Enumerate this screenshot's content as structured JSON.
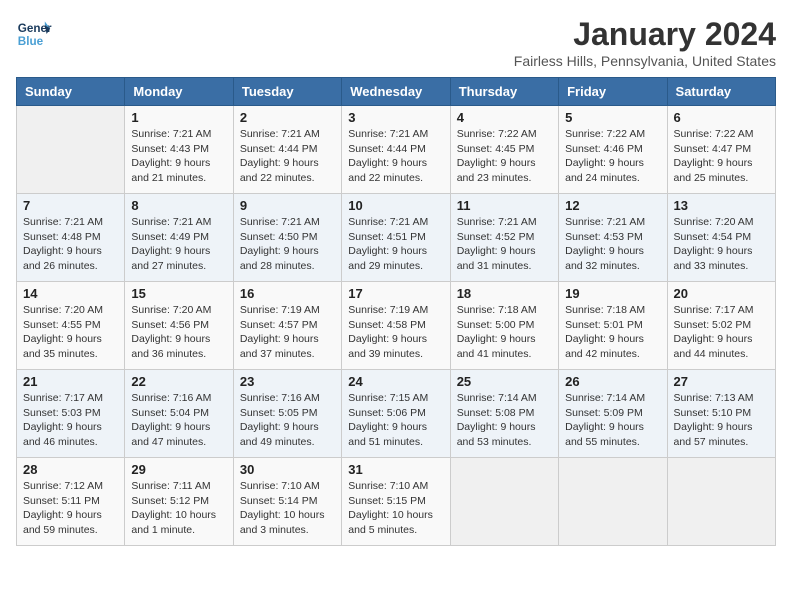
{
  "logo": {
    "line1": "General",
    "line2": "Blue"
  },
  "title": "January 2024",
  "location": "Fairless Hills, Pennsylvania, United States",
  "days_of_week": [
    "Sunday",
    "Monday",
    "Tuesday",
    "Wednesday",
    "Thursday",
    "Friday",
    "Saturday"
  ],
  "weeks": [
    [
      {
        "num": "",
        "info": ""
      },
      {
        "num": "1",
        "info": "Sunrise: 7:21 AM\nSunset: 4:43 PM\nDaylight: 9 hours\nand 21 minutes."
      },
      {
        "num": "2",
        "info": "Sunrise: 7:21 AM\nSunset: 4:44 PM\nDaylight: 9 hours\nand 22 minutes."
      },
      {
        "num": "3",
        "info": "Sunrise: 7:21 AM\nSunset: 4:44 PM\nDaylight: 9 hours\nand 22 minutes."
      },
      {
        "num": "4",
        "info": "Sunrise: 7:22 AM\nSunset: 4:45 PM\nDaylight: 9 hours\nand 23 minutes."
      },
      {
        "num": "5",
        "info": "Sunrise: 7:22 AM\nSunset: 4:46 PM\nDaylight: 9 hours\nand 24 minutes."
      },
      {
        "num": "6",
        "info": "Sunrise: 7:22 AM\nSunset: 4:47 PM\nDaylight: 9 hours\nand 25 minutes."
      }
    ],
    [
      {
        "num": "7",
        "info": "Sunrise: 7:21 AM\nSunset: 4:48 PM\nDaylight: 9 hours\nand 26 minutes."
      },
      {
        "num": "8",
        "info": "Sunrise: 7:21 AM\nSunset: 4:49 PM\nDaylight: 9 hours\nand 27 minutes."
      },
      {
        "num": "9",
        "info": "Sunrise: 7:21 AM\nSunset: 4:50 PM\nDaylight: 9 hours\nand 28 minutes."
      },
      {
        "num": "10",
        "info": "Sunrise: 7:21 AM\nSunset: 4:51 PM\nDaylight: 9 hours\nand 29 minutes."
      },
      {
        "num": "11",
        "info": "Sunrise: 7:21 AM\nSunset: 4:52 PM\nDaylight: 9 hours\nand 31 minutes."
      },
      {
        "num": "12",
        "info": "Sunrise: 7:21 AM\nSunset: 4:53 PM\nDaylight: 9 hours\nand 32 minutes."
      },
      {
        "num": "13",
        "info": "Sunrise: 7:20 AM\nSunset: 4:54 PM\nDaylight: 9 hours\nand 33 minutes."
      }
    ],
    [
      {
        "num": "14",
        "info": "Sunrise: 7:20 AM\nSunset: 4:55 PM\nDaylight: 9 hours\nand 35 minutes."
      },
      {
        "num": "15",
        "info": "Sunrise: 7:20 AM\nSunset: 4:56 PM\nDaylight: 9 hours\nand 36 minutes."
      },
      {
        "num": "16",
        "info": "Sunrise: 7:19 AM\nSunset: 4:57 PM\nDaylight: 9 hours\nand 37 minutes."
      },
      {
        "num": "17",
        "info": "Sunrise: 7:19 AM\nSunset: 4:58 PM\nDaylight: 9 hours\nand 39 minutes."
      },
      {
        "num": "18",
        "info": "Sunrise: 7:18 AM\nSunset: 5:00 PM\nDaylight: 9 hours\nand 41 minutes."
      },
      {
        "num": "19",
        "info": "Sunrise: 7:18 AM\nSunset: 5:01 PM\nDaylight: 9 hours\nand 42 minutes."
      },
      {
        "num": "20",
        "info": "Sunrise: 7:17 AM\nSunset: 5:02 PM\nDaylight: 9 hours\nand 44 minutes."
      }
    ],
    [
      {
        "num": "21",
        "info": "Sunrise: 7:17 AM\nSunset: 5:03 PM\nDaylight: 9 hours\nand 46 minutes."
      },
      {
        "num": "22",
        "info": "Sunrise: 7:16 AM\nSunset: 5:04 PM\nDaylight: 9 hours\nand 47 minutes."
      },
      {
        "num": "23",
        "info": "Sunrise: 7:16 AM\nSunset: 5:05 PM\nDaylight: 9 hours\nand 49 minutes."
      },
      {
        "num": "24",
        "info": "Sunrise: 7:15 AM\nSunset: 5:06 PM\nDaylight: 9 hours\nand 51 minutes."
      },
      {
        "num": "25",
        "info": "Sunrise: 7:14 AM\nSunset: 5:08 PM\nDaylight: 9 hours\nand 53 minutes."
      },
      {
        "num": "26",
        "info": "Sunrise: 7:14 AM\nSunset: 5:09 PM\nDaylight: 9 hours\nand 55 minutes."
      },
      {
        "num": "27",
        "info": "Sunrise: 7:13 AM\nSunset: 5:10 PM\nDaylight: 9 hours\nand 57 minutes."
      }
    ],
    [
      {
        "num": "28",
        "info": "Sunrise: 7:12 AM\nSunset: 5:11 PM\nDaylight: 9 hours\nand 59 minutes."
      },
      {
        "num": "29",
        "info": "Sunrise: 7:11 AM\nSunset: 5:12 PM\nDaylight: 10 hours\nand 1 minute."
      },
      {
        "num": "30",
        "info": "Sunrise: 7:10 AM\nSunset: 5:14 PM\nDaylight: 10 hours\nand 3 minutes."
      },
      {
        "num": "31",
        "info": "Sunrise: 7:10 AM\nSunset: 5:15 PM\nDaylight: 10 hours\nand 5 minutes."
      },
      {
        "num": "",
        "info": ""
      },
      {
        "num": "",
        "info": ""
      },
      {
        "num": "",
        "info": ""
      }
    ]
  ]
}
